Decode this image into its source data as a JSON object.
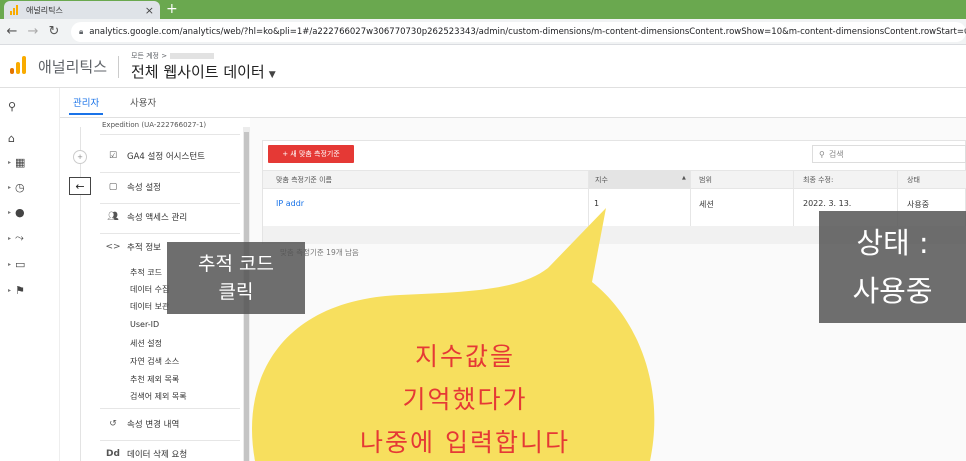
{
  "browser": {
    "tab_title": "애널리틱스",
    "close_glyph": "×",
    "new_tab_glyph": "+",
    "url": "analytics.google.com/analytics/web/?hl=ko&pli=1#/a222766027w306770730p262523343/admin/custom-dimensions/m-content-dimensionsContent.rowShow=10&m-content-dimensionsContent.rowStart=0&m-conte"
  },
  "header": {
    "app_name": "애널리틱스",
    "account_label": "모든 계정 >",
    "property_name": "전체 웹사이트 데이터"
  },
  "admin_tabs": [
    {
      "label": "관리자",
      "active": true
    },
    {
      "label": "사용자",
      "active": false
    }
  ],
  "property_nav": {
    "top_text": "Expedition (UA-222766027-1)",
    "items": [
      {
        "label": "GA4 설정 어시스턴트",
        "icon": "checkbox-icon"
      },
      {
        "label": "속성 설정",
        "icon": "window-icon"
      },
      {
        "label": "속성 액세스 관리",
        "icon": "people-icon"
      },
      {
        "label": "추적 정보",
        "icon": "code-icon"
      },
      {
        "label": "속성 변경 내역",
        "icon": "history-icon"
      },
      {
        "label": "데이터 삭제 요청",
        "icon": "dd-icon"
      }
    ],
    "sub_items": [
      "추적 코드",
      "데이터 수집",
      "데이터 보관",
      "User-ID",
      "세션 설정",
      "자연 검색 소스",
      "추천 제외 목록",
      "검색어 제외 목록"
    ]
  },
  "dimensions": {
    "new_button": "+ 새 맞춤 측정기준",
    "search_placeholder": "검색",
    "columns": [
      "맞춤 측정기준 이름",
      "지수",
      "범위",
      "최종 수정:",
      "상태"
    ],
    "rows": [
      {
        "name": "IP addr",
        "index": "1",
        "scope": "세션",
        "modified": "2022. 3. 13.",
        "status": "사용중"
      }
    ],
    "remaining": "맞춤 측정기준 19개 남음"
  },
  "annotations": {
    "track_code_line1": "추적 코드",
    "track_code_line2": "클릭",
    "status_line1": "상태 :",
    "status_line2": "사용중",
    "bubble_line1": "지수값을",
    "bubble_line2": "기억했다가",
    "bubble_line3": "나중에 입력합니다"
  },
  "colors": {
    "accent": "#1a73e8",
    "new_button": "#e53935",
    "bubble_fill": "#f7df5e",
    "bubble_text": "#e53935",
    "tab_strip": "#6aa84f"
  }
}
